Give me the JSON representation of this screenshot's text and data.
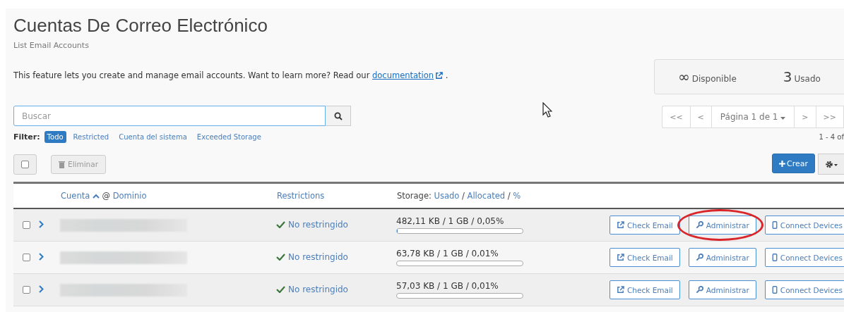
{
  "header": {
    "title": "Cuentas De Correo Electrónico",
    "subtitle": "List Email Accounts"
  },
  "intro": {
    "text": "This feature lets you create and manage email accounts. Want to learn more? Read our",
    "link": "documentation",
    "after": "."
  },
  "stats": [
    {
      "value": "∞",
      "label": "Disponible"
    },
    {
      "value": "3",
      "label": "Usado"
    }
  ],
  "search": {
    "placeholder": "Buscar"
  },
  "filter": {
    "label": "Filter:",
    "options": [
      {
        "label": "Todo",
        "selected": true
      },
      {
        "label": "Restricted",
        "selected": false
      },
      {
        "label": "Cuenta del sistema",
        "selected": false
      },
      {
        "label": "Exceeded Storage",
        "selected": false
      }
    ]
  },
  "pagination": {
    "first": "<<",
    "prev": "<",
    "page": "Página 1 de 1",
    "next": ">",
    "last": ">>",
    "range": "1 - 4 of"
  },
  "toolbar": {
    "select_all": false,
    "delete": "Eliminar",
    "create": "Crear"
  },
  "table": {
    "columns": {
      "account": "Cuenta",
      "at": "@",
      "domain": "Dominio",
      "restrictions": "Restrictions",
      "storage": "Storage:",
      "used": "Usado",
      "sep1": "/",
      "allocated": "Allocated",
      "sep2": "/",
      "percent": "%"
    },
    "rows": [
      {
        "checked": false,
        "restriction": "No restringido",
        "storage": "482,11 KB / 1 GB / 0,05%",
        "level": 0.0005,
        "actions": [
          "Check Email",
          "Administrar",
          "Connect Devices"
        ],
        "circled": true
      },
      {
        "checked": false,
        "restriction": "No restringido",
        "storage": "63,78 KB / 1 GB / 0,01%",
        "level": 0.0001,
        "actions": [
          "Check Email",
          "Administrar",
          "Connect Devices"
        ],
        "circled": false
      },
      {
        "checked": false,
        "restriction": "No restringido",
        "storage": "57,03 KB / 1 GB / 0,01%",
        "level": 0.0001,
        "actions": [
          "Check Email",
          "Administrar",
          "Connect Devices"
        ],
        "circled": false
      }
    ]
  }
}
